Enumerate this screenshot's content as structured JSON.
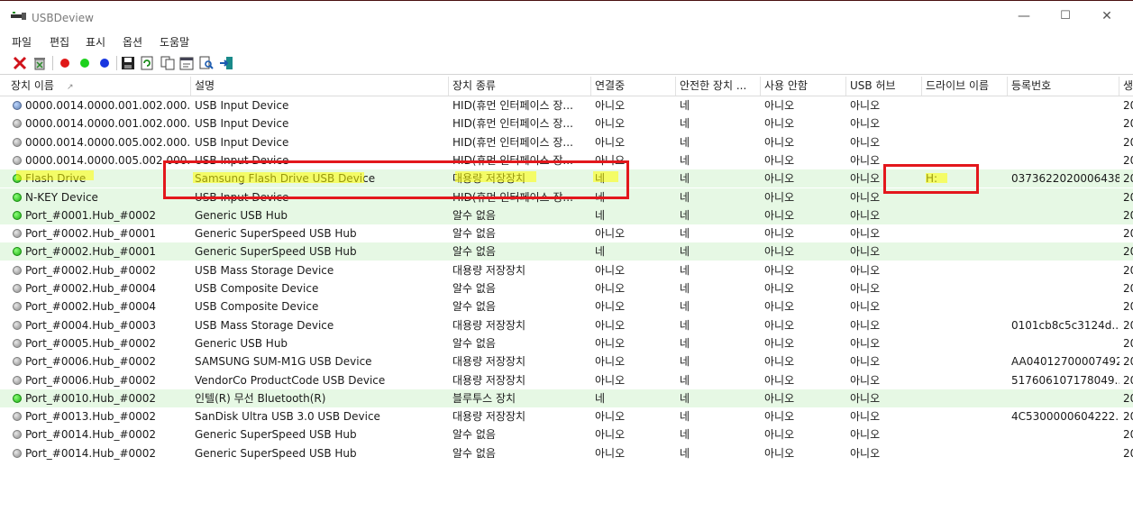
{
  "window": {
    "title": "USBDeview"
  },
  "menu": [
    "파일",
    "편집",
    "표시",
    "옵션",
    "도움말"
  ],
  "toolbar": [
    "disconnect-icon",
    "uninstall-icon",
    "red-dot-icon",
    "green-dot-icon",
    "blue-dot-icon",
    "save-icon",
    "refresh-icon",
    "copy-icon",
    "properties-icon",
    "find-icon",
    "exit-icon"
  ],
  "columns": [
    "장치 이름",
    "설명",
    "장치 종류",
    "연결중",
    "안전한 장치 ...",
    "사용 안함",
    "USB 허브",
    "드라이브 이름",
    "등록번호",
    "생"
  ],
  "rows": [
    {
      "status": "blue",
      "name": "0000.0014.0000.001.002.000.0...",
      "desc": "USB Input Device",
      "type": "HID(휴먼 인터페이스 장...",
      "connected": "아니오",
      "safe": "네",
      "disabled": "아니오",
      "hub": "아니오",
      "drive": "",
      "serial": "",
      "cut": "20"
    },
    {
      "status": "gray",
      "name": "0000.0014.0000.001.002.000.0...",
      "desc": "USB Input Device",
      "type": "HID(휴먼 인터페이스 장...",
      "connected": "아니오",
      "safe": "네",
      "disabled": "아니오",
      "hub": "아니오",
      "drive": "",
      "serial": "",
      "cut": "20"
    },
    {
      "status": "gray",
      "name": "0000.0014.0000.005.002.000.0...",
      "desc": "USB Input Device",
      "type": "HID(휴먼 인터페이스 장...",
      "connected": "아니오",
      "safe": "네",
      "disabled": "아니오",
      "hub": "아니오",
      "drive": "",
      "serial": "",
      "cut": "20"
    },
    {
      "status": "gray",
      "name": "0000.0014.0000.005.002.000.0...",
      "desc": "USB Input Device",
      "type": "HID(휴먼 인터페이스 장...",
      "connected": "아니오",
      "safe": "네",
      "disabled": "아니오",
      "hub": "아니오",
      "drive": "",
      "serial": "",
      "cut": "20"
    },
    {
      "status": "green",
      "name": "Flash Drive",
      "desc": "Samsung Flash Drive USB Device",
      "type": "대용량 저장장치",
      "connected": "네",
      "safe": "네",
      "disabled": "아니오",
      "hub": "아니오",
      "drive": "H:",
      "serial": "0373622020006438",
      "cut": "20"
    },
    {
      "status": "green",
      "name": "N-KEY Device",
      "desc": "USB Input Device",
      "type": "HID(휴먼 인터페이스 장...",
      "connected": "네",
      "safe": "네",
      "disabled": "아니오",
      "hub": "아니오",
      "drive": "",
      "serial": "",
      "cut": "20"
    },
    {
      "status": "green",
      "name": "Port_#0001.Hub_#0002",
      "desc": "Generic USB Hub",
      "type": "알수 없음",
      "connected": "네",
      "safe": "네",
      "disabled": "아니오",
      "hub": "아니오",
      "drive": "",
      "serial": "",
      "cut": "20"
    },
    {
      "status": "gray",
      "name": "Port_#0002.Hub_#0001",
      "desc": "Generic SuperSpeed USB Hub",
      "type": "알수 없음",
      "connected": "아니오",
      "safe": "네",
      "disabled": "아니오",
      "hub": "아니오",
      "drive": "",
      "serial": "",
      "cut": "20"
    },
    {
      "status": "green",
      "name": "Port_#0002.Hub_#0001",
      "desc": "Generic SuperSpeed USB Hub",
      "type": "알수 없음",
      "connected": "네",
      "safe": "네",
      "disabled": "아니오",
      "hub": "아니오",
      "drive": "",
      "serial": "",
      "cut": "20"
    },
    {
      "status": "gray",
      "name": "Port_#0002.Hub_#0002",
      "desc": "USB Mass Storage Device",
      "type": "대용량 저장장치",
      "connected": "아니오",
      "safe": "네",
      "disabled": "아니오",
      "hub": "아니오",
      "drive": "",
      "serial": "",
      "cut": "20"
    },
    {
      "status": "gray",
      "name": "Port_#0002.Hub_#0004",
      "desc": "USB Composite Device",
      "type": "알수 없음",
      "connected": "아니오",
      "safe": "네",
      "disabled": "아니오",
      "hub": "아니오",
      "drive": "",
      "serial": "",
      "cut": "20"
    },
    {
      "status": "gray",
      "name": "Port_#0002.Hub_#0004",
      "desc": "USB Composite Device",
      "type": "알수 없음",
      "connected": "아니오",
      "safe": "네",
      "disabled": "아니오",
      "hub": "아니오",
      "drive": "",
      "serial": "",
      "cut": "20"
    },
    {
      "status": "gray",
      "name": "Port_#0004.Hub_#0003",
      "desc": "USB Mass Storage Device",
      "type": "대용량 저장장치",
      "connected": "아니오",
      "safe": "네",
      "disabled": "아니오",
      "hub": "아니오",
      "drive": "",
      "serial": "0101cb8c5c3124d...",
      "cut": "20"
    },
    {
      "status": "gray",
      "name": "Port_#0005.Hub_#0002",
      "desc": "Generic USB Hub",
      "type": "알수 없음",
      "connected": "아니오",
      "safe": "네",
      "disabled": "아니오",
      "hub": "아니오",
      "drive": "",
      "serial": "",
      "cut": "20"
    },
    {
      "status": "gray",
      "name": "Port_#0006.Hub_#0002",
      "desc": "SAMSUNG SUM-M1G USB Device",
      "type": "대용량 저장장치",
      "connected": "아니오",
      "safe": "네",
      "disabled": "아니오",
      "hub": "아니오",
      "drive": "",
      "serial": "AA04012700007492",
      "cut": "20"
    },
    {
      "status": "gray",
      "name": "Port_#0006.Hub_#0002",
      "desc": "VendorCo ProductCode USB Device",
      "type": "대용량 저장장치",
      "connected": "아니오",
      "safe": "네",
      "disabled": "아니오",
      "hub": "아니오",
      "drive": "",
      "serial": "517606107178049...",
      "cut": "20"
    },
    {
      "status": "green",
      "name": "Port_#0010.Hub_#0002",
      "desc": "인텔(R) 무선 Bluetooth(R)",
      "type": "블루투스 장치",
      "connected": "네",
      "safe": "네",
      "disabled": "아니오",
      "hub": "아니오",
      "drive": "",
      "serial": "",
      "cut": "20"
    },
    {
      "status": "gray",
      "name": "Port_#0013.Hub_#0002",
      "desc": "SanDisk Ultra USB 3.0 USB Device",
      "type": "대용량 저장장치",
      "connected": "아니오",
      "safe": "네",
      "disabled": "아니오",
      "hub": "아니오",
      "drive": "",
      "serial": "4C5300000604222...",
      "cut": "20"
    },
    {
      "status": "gray",
      "name": "Port_#0014.Hub_#0002",
      "desc": "Generic SuperSpeed USB Hub",
      "type": "알수 없음",
      "connected": "아니오",
      "safe": "네",
      "disabled": "아니오",
      "hub": "아니오",
      "drive": "",
      "serial": "",
      "cut": "20"
    },
    {
      "status": "gray",
      "name": "Port_#0014.Hub_#0002",
      "desc": "Generic SuperSpeed USB Hub",
      "type": "알수 없음",
      "connected": "아니오",
      "safe": "네",
      "disabled": "아니오",
      "hub": "아니오",
      "drive": "",
      "serial": "",
      "cut": "20"
    }
  ],
  "colors": {
    "highlight_row": "#e6f8e4",
    "annotation_red": "#e3171c",
    "marker_yellow": "#ffff00"
  }
}
